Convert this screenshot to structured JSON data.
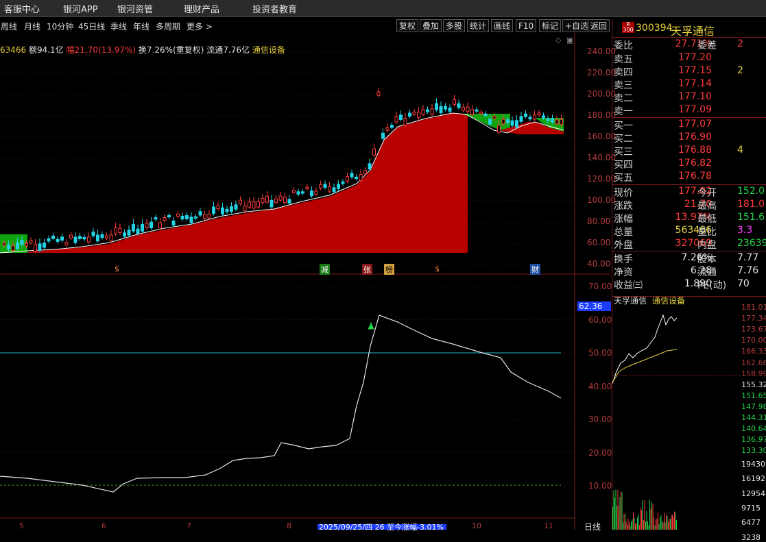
{
  "menu": [
    "客服中心",
    "银河APP",
    "银河资管",
    "理财产品",
    "投资者教育"
  ],
  "periods": [
    "周线",
    "月线",
    "10分钟",
    "45日线",
    "季线",
    "年线",
    "多周期",
    "更多 >"
  ],
  "tools": [
    "复权",
    "叠加",
    "多股",
    "统计",
    "画线",
    "F10",
    "标记",
    "+自选",
    "返回"
  ],
  "info": {
    "vol": "63466",
    "amount_label": "额",
    "amount": "94.1亿",
    "chg_label": "幅",
    "chg": "21.70(13.97%)",
    "turnover": "换7.26%(重复权)",
    "float": "流通7.76亿",
    "industry": "通信设备"
  },
  "price_axis": [
    "240.00",
    "220.00",
    "200.00",
    "180.00",
    "160.00",
    "140.00",
    "120.00",
    "100.00",
    "80.00",
    "60.00",
    "40.00"
  ],
  "markers": [
    "$",
    "减",
    "张",
    "榜",
    "$",
    "财"
  ],
  "ind_axis": [
    "70.00",
    "60.00",
    "50.00",
    "40.00",
    "30.00",
    "20.00",
    "10.00"
  ],
  "ind_current": "62.36",
  "date_bar": {
    "ticks": [
      "5",
      "6",
      "7",
      "8",
      "10",
      "11"
    ],
    "highlight": "2025/09/25/四 26 至今涨幅-3.01%",
    "period_label": "日线"
  },
  "stock": {
    "badge_top": "R",
    "badge_bottom": "300",
    "code": "300394",
    "name": "天孚通信"
  },
  "quote": {
    "weibi_label": "委比",
    "weibi": "27.71%",
    "weicha_label": "委差",
    "weicha": "2",
    "sell": [
      {
        "label": "卖五",
        "price": "177.20",
        "vol": ""
      },
      {
        "label": "卖四",
        "price": "177.15",
        "vol": "2"
      },
      {
        "label": "卖三",
        "price": "177.14",
        "vol": ""
      },
      {
        "label": "卖二",
        "price": "177.10",
        "vol": ""
      },
      {
        "label": "卖一",
        "price": "177.09",
        "vol": ""
      }
    ],
    "buy": [
      {
        "label": "买一",
        "price": "177.07",
        "vol": ""
      },
      {
        "label": "买二",
        "price": "176.90",
        "vol": ""
      },
      {
        "label": "买三",
        "price": "176.88",
        "vol": "4"
      },
      {
        "label": "买四",
        "price": "176.82",
        "vol": ""
      },
      {
        "label": "买五",
        "price": "176.78",
        "vol": ""
      }
    ],
    "stats": [
      {
        "l1": "现价",
        "v1": "177.02",
        "c1": "#ff3b3b",
        "l2": "今开",
        "v2": "152.0",
        "c2": "#22d34a"
      },
      {
        "l1": "涨跌",
        "v1": "21.70",
        "c1": "#ff3b3b",
        "l2": "最高",
        "v2": "181.0",
        "c2": "#ff3b3b"
      },
      {
        "l1": "涨幅",
        "v1": "13.97%",
        "c1": "#ff3b3b",
        "l2": "最低",
        "v2": "151.6",
        "c2": "#22d34a"
      },
      {
        "l1": "总量",
        "v1": "563466",
        "c1": "#e6d23c",
        "l2": "量比",
        "v2": "3.3",
        "c2": "#ff3bff"
      },
      {
        "l1": "外盘",
        "v1": "327069",
        "c1": "#ff3b3b",
        "l2": "内盘",
        "v2": "23639",
        "c2": "#22d34a"
      }
    ],
    "stats2": [
      {
        "l1": "换手",
        "v1": "7.26%",
        "l2": "股本",
        "v2": "7.77"
      },
      {
        "l1": "净资",
        "v1": "6.28",
        "l2": "流通",
        "v2": "7.76"
      },
      {
        "l1": "收益㈢",
        "v1": "1.890",
        "l2": "PE(动)",
        "v2": "70"
      }
    ]
  },
  "mini": {
    "name": "天孚通信",
    "industry": "通信设备",
    "price_ticks": [
      "181.01",
      "177.34",
      "173.67",
      "170.00",
      "166.33",
      "162.66",
      "158.99",
      "155.32",
      "151.65",
      "147.98",
      "144.31",
      "140.64",
      "136.97",
      "133.30"
    ],
    "vol_ticks": [
      "19430",
      "16192",
      "12954",
      "9715",
      "6477",
      "3238"
    ]
  },
  "colors": {
    "up": "#ff3b3b",
    "down": "#22d3e6",
    "fill": "#b80000",
    "green_band": "#11a411",
    "bg": "#000000"
  }
}
